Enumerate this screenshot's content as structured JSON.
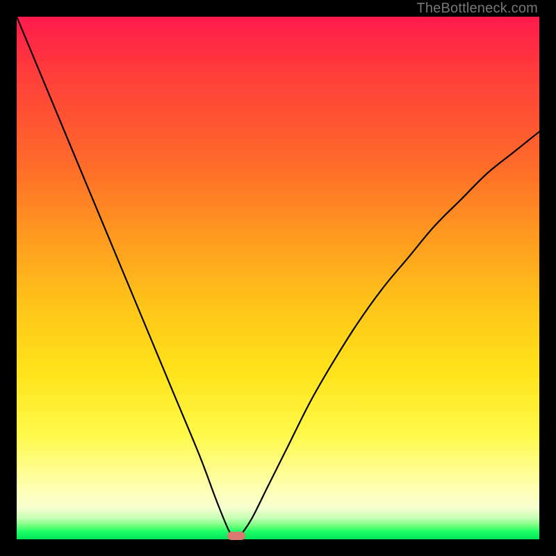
{
  "watermark": "TheBottleneck.com",
  "colors": {
    "frame": "#000000",
    "curve": "#000000",
    "marker": "#d87a70"
  },
  "chart_data": {
    "type": "line",
    "title": "",
    "xlabel": "",
    "ylabel": "",
    "xlim": [
      0,
      100
    ],
    "ylim": [
      0,
      100
    ],
    "grid": false,
    "series": [
      {
        "name": "bottleneck-curve",
        "x": [
          0,
          5,
          10,
          15,
          20,
          25,
          30,
          35,
          38,
          40,
          41,
          42,
          43,
          45,
          48,
          52,
          56,
          60,
          65,
          70,
          75,
          80,
          85,
          90,
          95,
          100
        ],
        "y": [
          100,
          88,
          76,
          64,
          52,
          40,
          28,
          16,
          8,
          3,
          1,
          0,
          1,
          4,
          10,
          18,
          26,
          33,
          41,
          48,
          54,
          60,
          65,
          70,
          74,
          78
        ]
      }
    ],
    "marker": {
      "x": 42,
      "y": 0
    },
    "gradient_stops": [
      {
        "pos": 0.0,
        "color": "#ff1a4d"
      },
      {
        "pos": 0.1,
        "color": "#ff3b3b"
      },
      {
        "pos": 0.28,
        "color": "#ff6a2a"
      },
      {
        "pos": 0.42,
        "color": "#ff9a1f"
      },
      {
        "pos": 0.55,
        "color": "#ffc41a"
      },
      {
        "pos": 0.68,
        "color": "#ffe31a"
      },
      {
        "pos": 0.8,
        "color": "#fff94a"
      },
      {
        "pos": 0.9,
        "color": "#ffffb0"
      },
      {
        "pos": 0.94,
        "color": "#f6ffd0"
      },
      {
        "pos": 0.96,
        "color": "#c4ffb4"
      },
      {
        "pos": 0.975,
        "color": "#6dff7a"
      },
      {
        "pos": 0.985,
        "color": "#1dff67"
      },
      {
        "pos": 1.0,
        "color": "#00e45a"
      }
    ]
  }
}
